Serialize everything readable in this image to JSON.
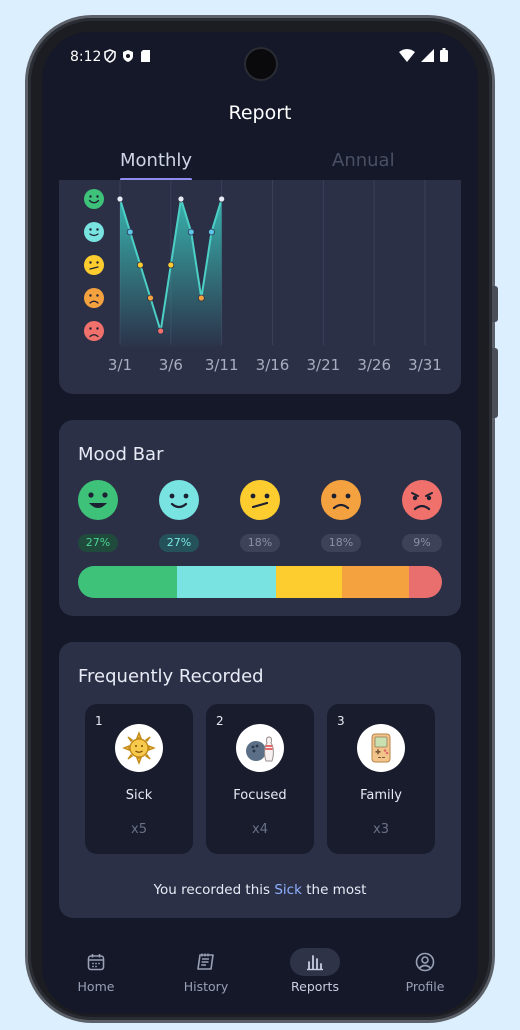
{
  "status_bar": {
    "time": "8:12"
  },
  "header": {
    "title": "Report"
  },
  "tabs": [
    {
      "label": "Monthly",
      "active": true
    },
    {
      "label": "Annual",
      "active": false
    }
  ],
  "chart_data": {
    "type": "line",
    "x_tick_labels": [
      "3/1",
      "3/6",
      "3/11",
      "3/16",
      "3/21",
      "3/26",
      "3/31"
    ],
    "y_levels": [
      "very-happy",
      "happy",
      "neutral",
      "sad",
      "very-sad"
    ],
    "x": [
      1,
      2,
      3,
      4,
      5,
      6,
      7,
      8,
      9,
      10,
      11
    ],
    "values": [
      5,
      4,
      3,
      2,
      1,
      3,
      5,
      4,
      2,
      4,
      5
    ],
    "ylim": [
      1,
      5
    ]
  },
  "mood_bar": {
    "title": "Mood Bar",
    "items": [
      {
        "mood": "very-happy",
        "percent": "27%",
        "color": "#3ec27a"
      },
      {
        "mood": "happy",
        "percent": "27%",
        "color": "#78e3e0"
      },
      {
        "mood": "neutral",
        "percent": "18%",
        "color": "#fdcd2f"
      },
      {
        "mood": "sad",
        "percent": "18%",
        "color": "#f4a13f"
      },
      {
        "mood": "very-sad",
        "percent": "9%",
        "color": "#f0706c"
      }
    ],
    "distribution": [
      27,
      27,
      18,
      18,
      9
    ]
  },
  "frequent": {
    "title": "Frequently Recorded",
    "items": [
      {
        "rank": "1",
        "name": "Sick",
        "count": "x5",
        "icon": "sun-icon"
      },
      {
        "rank": "2",
        "name": "Focused",
        "count": "x4",
        "icon": "bowling-icon"
      },
      {
        "rank": "3",
        "name": "Family",
        "count": "x3",
        "icon": "gameboy-icon"
      }
    ],
    "summary_prefix": "You recorded this",
    "summary_highlight": "Sick",
    "summary_suffix": "the most"
  },
  "nav": [
    {
      "label": "Home",
      "icon": "calendar-icon"
    },
    {
      "label": "History",
      "icon": "notebook-icon"
    },
    {
      "label": "Reports",
      "icon": "bar-chart-icon",
      "active": true
    },
    {
      "label": "Profile",
      "icon": "user-circle-icon"
    }
  ]
}
